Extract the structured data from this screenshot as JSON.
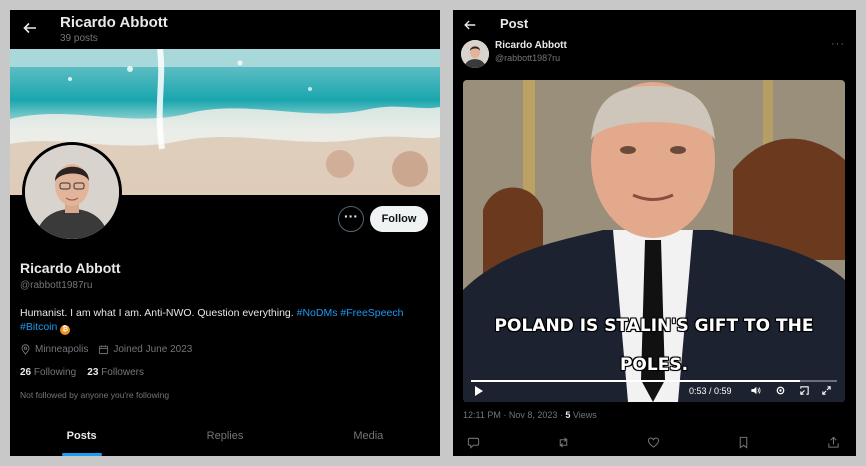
{
  "profile": {
    "top_name": "Ricardo Abbott",
    "posts_count": "39 posts",
    "more_label": "···",
    "follow_label": "Follow",
    "name": "Ricardo Abbott",
    "handle": "@rabbott1987ru",
    "bio_text": "Humanist. I am what I am. Anti-NWO. Question everything.",
    "bio_tags": [
      "#NoDMs",
      "#FreeSpeech",
      "#Bitcoin"
    ],
    "btc_glyph": "₿",
    "location": "Minneapolis",
    "joined": "Joined June 2023",
    "following_count": "26",
    "following_label": "Following",
    "followers_count": "23",
    "followers_label": "Followers",
    "not_followed": "Not followed by anyone you're following",
    "tabs": [
      "Posts",
      "Replies",
      "Media"
    ],
    "active_tab": 0
  },
  "post": {
    "title": "Post",
    "author_name": "Ricardo Abbott",
    "author_handle": "@rabbott1987ru",
    "more_label": "···",
    "caption_line1": "POLAND IS STALIN'S GIFT TO THE",
    "caption_line2": "POLES.",
    "video_time": "0:53 / 0:59",
    "video_progress": 0.9,
    "timestamp": "12:11 PM · Nov 8, 2023 · ",
    "views_count": "5",
    "views_label": " Views"
  },
  "colors": {
    "background": "#000000",
    "accent": "#1d9bf0",
    "muted": "#71767b",
    "text": "#e7e9ea"
  },
  "icons": [
    "back-arrow-icon",
    "location-pin-icon",
    "calendar-icon",
    "play-icon",
    "volume-icon",
    "settings-icon",
    "exit-fullscreen-icon",
    "fullscreen-icon",
    "reply-icon",
    "repost-icon",
    "like-icon",
    "bookmark-icon",
    "share-icon"
  ]
}
